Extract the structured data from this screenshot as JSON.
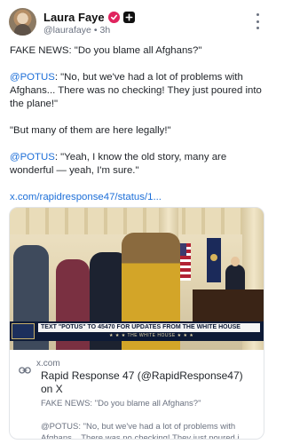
{
  "post": {
    "author_name": "Laura Faye",
    "handle": "@laurafaye",
    "separator": "•",
    "time": "3h",
    "body": {
      "line1": "FAKE NEWS: \"Do you blame all Afghans?\"",
      "q1_mention": "@POTUS",
      "q1_text": ": \"No, but we've had a lot of problems with Afghans... There was no checking! They just poured into the plane!\"",
      "line3": "\"But many of them are here legally!\"",
      "q2_mention": "@POTUS",
      "q2_text": ": \"Yeah, I know the old story, many are wonderful — yeah, I'm sure.\"",
      "link": "x.com/rapidresponse47/status/1..."
    }
  },
  "card": {
    "media": {
      "ticker_text": "TEXT \"POTUS\" TO 45470 FOR UPDATES FROM THE WHITE HOUSE",
      "sub_ticker": "★ ★ ★ THE WHITE HOUSE ★ ★ ★"
    },
    "domain": "x.com",
    "title": "Rapid Response 47 (@RapidResponse47) on X",
    "desc_line1": "FAKE NEWS: \"Do you blame all Afghans?\"",
    "desc_line2": "@POTUS: \"No, but we've had a lot of problems with",
    "desc_line3": "Afghans... There was no checking! They just poured i..."
  },
  "icons": {
    "verified": "verified-badge-icon",
    "plus": "plus-badge-icon",
    "more": "more-vertical-icon",
    "link": "link-icon"
  },
  "colors": {
    "link": "#1d6fd8",
    "verified": "#e0245e",
    "muted": "#6b7280"
  }
}
